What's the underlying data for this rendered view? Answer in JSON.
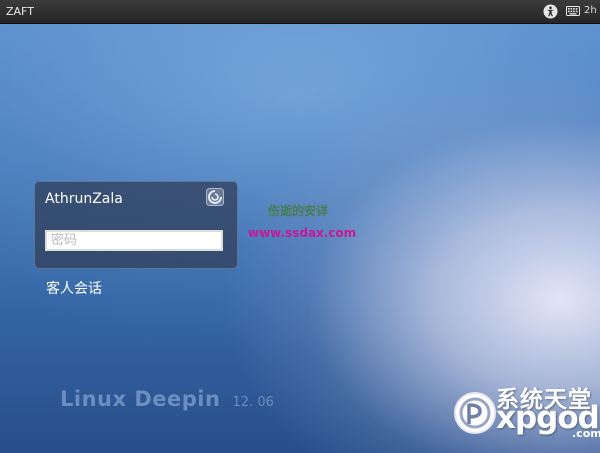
{
  "topbar": {
    "hostname": "ZAFT",
    "clock": "2h"
  },
  "login": {
    "username": "AthrunZala",
    "password_placeholder": "密码",
    "guest_session": "客人会话"
  },
  "watermark": {
    "title": "伤逝的安详",
    "url": "www.ssdax.com"
  },
  "brand": {
    "name": "Linux Deepin",
    "version": "12. 06"
  },
  "logo": {
    "chinese": "系统天堂",
    "latin": "xpgod",
    "suffix": ".com"
  },
  "icons": {
    "topbar": [
      "accessibility-icon",
      "keyboard-icon"
    ],
    "card": "session-icon",
    "logo": "xpgod-logo-icon"
  }
}
